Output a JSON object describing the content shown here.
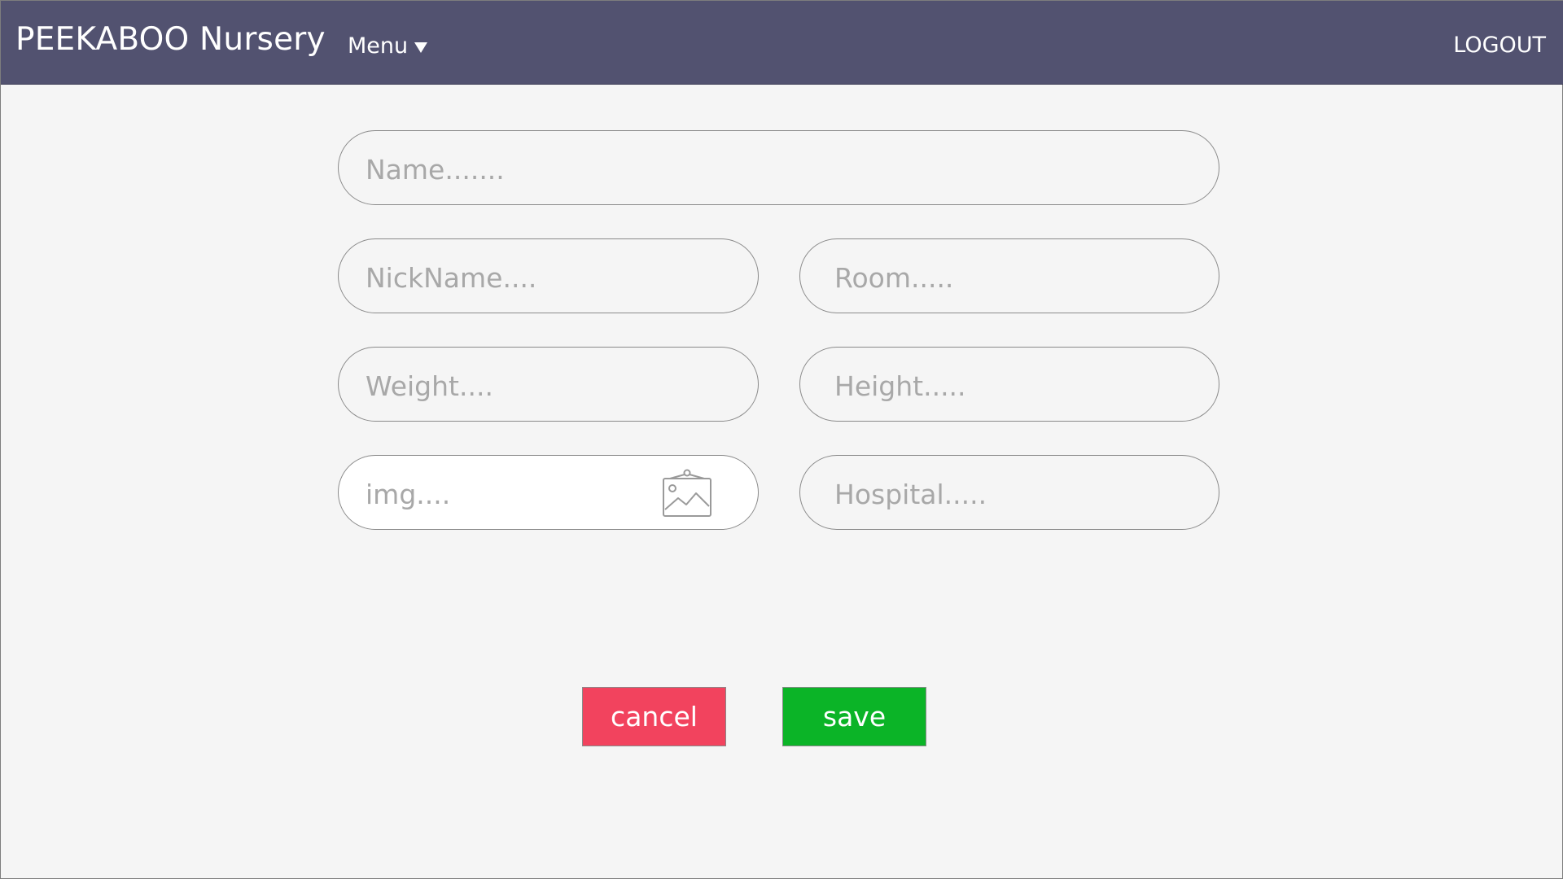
{
  "header": {
    "brand": "PEEKABOO Nursery",
    "menu_label": "Menu",
    "logout_label": "LOGOUT",
    "background_color": "#525270"
  },
  "form": {
    "name_placeholder": "Name.......",
    "nickname_placeholder": "NickName....",
    "room_placeholder": "Room.....",
    "weight_placeholder": "Weight....",
    "height_placeholder": "Height.....",
    "img_placeholder": "img....",
    "img_icon": "image-icon",
    "hospital_placeholder": "Hospital....."
  },
  "actions": {
    "cancel_label": "cancel",
    "cancel_color": "#f2435e",
    "save_label": "save",
    "save_color": "#0bb427"
  }
}
